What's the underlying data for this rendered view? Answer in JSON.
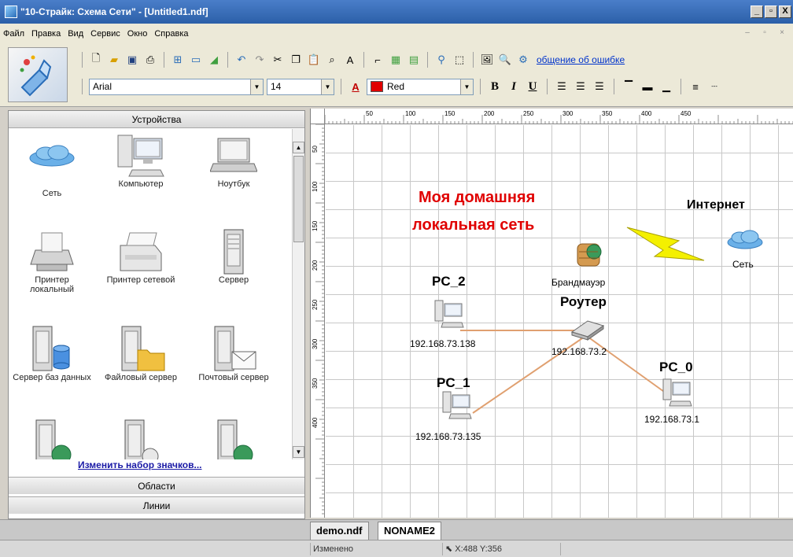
{
  "window": {
    "title": "\"10-Страйк: Схема Сети\" - [Untitled1.ndf]",
    "buttons": {
      "minimize": "_",
      "maximize": "▫",
      "close": "X"
    }
  },
  "menu": {
    "items": [
      "Файл",
      "Правка",
      "Вид",
      "Сервис",
      "Окно",
      "Справка"
    ],
    "mdi_minimize": "–",
    "mdi_restore": "▫",
    "mdi_close": "×"
  },
  "toolbar": {
    "report_link": "общение об ошибке",
    "font_name": "Arial",
    "font_size": "14",
    "color_name": "Red",
    "color_swatch": "#e00000",
    "bold": "B",
    "italic": "I",
    "underline": "U"
  },
  "sidebar": {
    "section_devices": "Устройства",
    "devices": [
      {
        "label": "Сеть",
        "icon": "cloud-icon"
      },
      {
        "label": "Компьютер",
        "icon": "computer-icon"
      },
      {
        "label": "Ноутбук",
        "icon": "laptop-icon"
      },
      {
        "label": "Принтер локальный",
        "icon": "printer-icon"
      },
      {
        "label": "Принтер сетевой",
        "icon": "network-printer-icon"
      },
      {
        "label": "Сервер",
        "icon": "server-icon"
      },
      {
        "label": "Сервер баз данных",
        "icon": "database-server-icon"
      },
      {
        "label": "Файловый сервер",
        "icon": "file-server-icon"
      },
      {
        "label": "Почтовый сервер",
        "icon": "mail-server-icon"
      },
      {
        "label": "",
        "icon": "web-server-icon"
      },
      {
        "label": "",
        "icon": "server-icon"
      },
      {
        "label": "",
        "icon": "web-server-icon"
      }
    ],
    "change_icons_link": "Изменить набор значков...",
    "section_areas": "Области",
    "section_lines": "Линии"
  },
  "diagram": {
    "title_line1": "Моя домашняя",
    "title_line2": "локальная сеть",
    "title_color": "#e00000",
    "internet_label": "Интернет",
    "cloud_label": "Сеть",
    "firewall_label": "Брандмауэр",
    "router_label": "Роутер",
    "router_ip": "192.168.73.2",
    "pc2_label": "PC_2",
    "pc2_ip": "192.168.73.138",
    "pc1_label": "PC_1",
    "pc1_ip": "192.168.73.135",
    "pc0_label": "PC_0",
    "pc0_ip": "192.168.73.1",
    "link_color": "#e0a070",
    "ruler_top": [
      "50",
      "100",
      "150",
      "200",
      "250",
      "300",
      "350",
      "400",
      "450"
    ],
    "ruler_left": [
      "50",
      "100",
      "150",
      "200",
      "250",
      "300",
      "350",
      "400"
    ]
  },
  "tabs": [
    "demo.ndf",
    "NONAME2"
  ],
  "status": {
    "modified": "Изменено",
    "coords": "X:488  Y:356"
  }
}
